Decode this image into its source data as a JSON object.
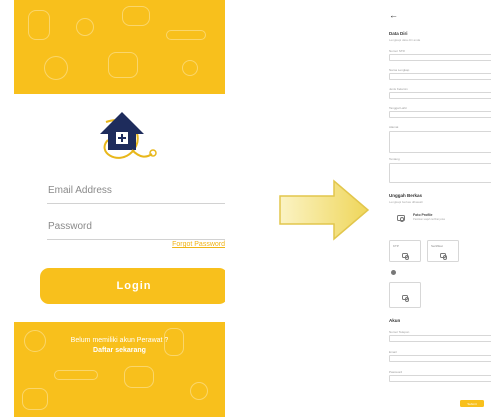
{
  "login": {
    "email_placeholder": "Email Address",
    "password_placeholder": "Password",
    "forgot_password": "Forgot Password",
    "login_button": "Login",
    "no_account_text": "Belum memiliki akun Perawat ?",
    "register_link": "Daftar sekarang"
  },
  "register": {
    "back_icon": "←",
    "personal_section": {
      "title": "Data Diri",
      "subtitle": "Lengkapi data diri anda",
      "fields": [
        {
          "label": "Nomor STR"
        },
        {
          "label": "Nama Lengkap"
        },
        {
          "label": "Jenis Kelamin"
        },
        {
          "label": "Tanggal Lahir"
        },
        {
          "label": "Alamat"
        },
        {
          "label": "Tentang"
        }
      ]
    },
    "upload_section": {
      "title": "Unggah Berkas",
      "subtitle": "Lengkapi berkas dibawah",
      "profile_photo_label": "Foto Profile",
      "profile_photo_hint": "Pastikan wajah terlihat jelas",
      "ktp_label": "KTP",
      "certificate_label": "Sertifikat"
    },
    "account_section": {
      "title": "Akun",
      "fields": [
        {
          "label": "Nomor Telepon"
        },
        {
          "label": "Email"
        },
        {
          "label": "Password"
        }
      ]
    },
    "submit_button": "Submit"
  },
  "colors": {
    "accent": "#f8c01c",
    "logo_blue": "#1e2c5c",
    "arrow_fill": "#f5e48a"
  },
  "icons": [
    "house-plug-logo",
    "camera-icon",
    "info-icon",
    "back-arrow-icon",
    "right-arrow-graphic"
  ]
}
